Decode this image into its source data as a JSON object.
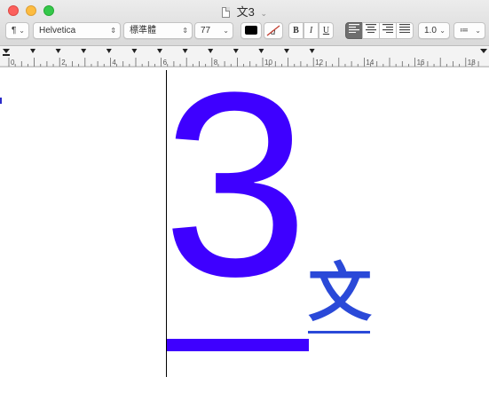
{
  "window": {
    "title": "文3",
    "title_chevron": "⌄"
  },
  "toolbar": {
    "paragraph_style": "¶",
    "font_family": "Helvetica",
    "font_typeface": "標準體",
    "font_size": "77",
    "bold": "B",
    "italic": "I",
    "underline": "U",
    "line_spacing": "1.0",
    "list_icon": "≔"
  },
  "ruler": {
    "labels": [
      "0",
      "2",
      "4",
      "6",
      "8",
      "10",
      "12",
      "14",
      "16",
      "18"
    ]
  },
  "document": {
    "text_main": "3",
    "text_secondary": "文",
    "colors": {
      "main": "#3e00ff",
      "secondary": "#2a49d8"
    }
  }
}
